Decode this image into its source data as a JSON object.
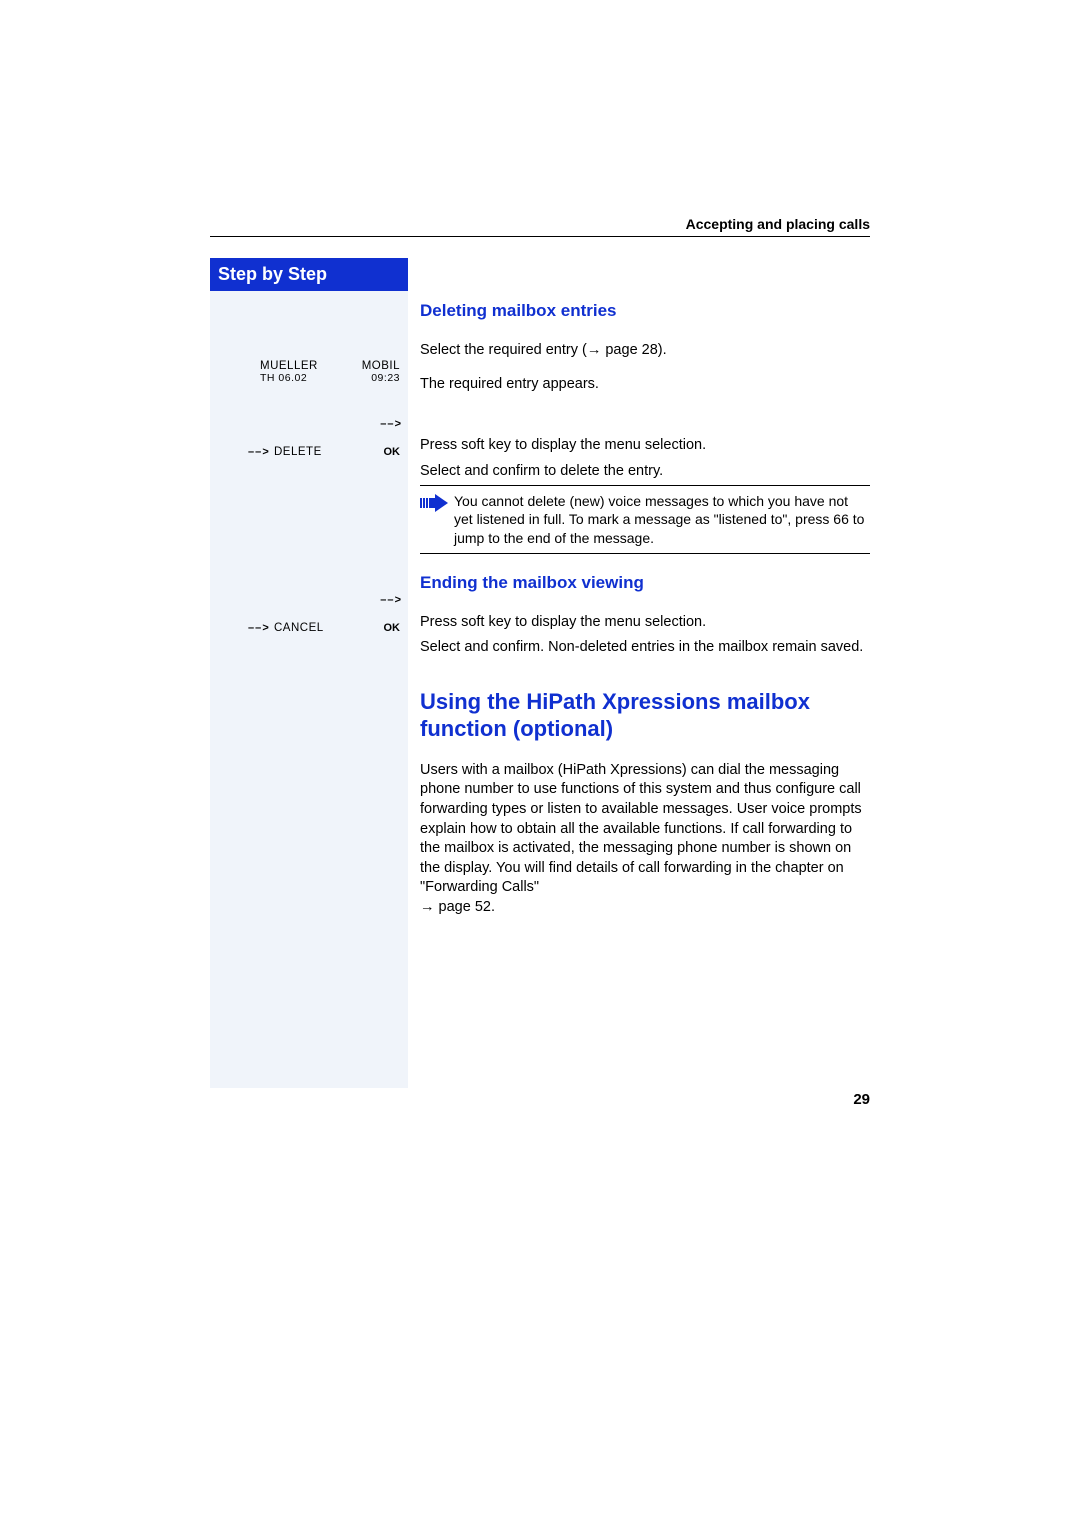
{
  "header": {
    "section_title": "Accepting and placing calls"
  },
  "left": {
    "step_title": "Step by Step",
    "phone_display": {
      "name": "MUELLER",
      "type": "MOBIL",
      "date": "TH 06.02",
      "time": "09:23"
    },
    "arrow_glyph": "– – >",
    "step_delete": {
      "prefix": "– – >",
      "label": "DELETE",
      "ok": "OK"
    },
    "step_cancel_arrow": "– – >",
    "step_cancel": {
      "prefix": "– – >",
      "label": "CANCEL",
      "ok": "OK"
    }
  },
  "right": {
    "h3_delete": "Deleting mailbox entries",
    "p_select_required": "Select the required entry (",
    "p_select_required_link": " page 28).",
    "p_required_appears": "The required entry appears.",
    "p_press_soft_1": "Press soft key to display the menu selection.",
    "p_select_confirm_delete": "Select and confirm to delete the entry.",
    "note_text": "You cannot delete (new) voice messages to which you have not yet listened in full. To mark a message as \"listened to\", press 66 to jump to the end of the message.",
    "h3_end": "Ending the mailbox viewing",
    "p_press_soft_2": "Press soft key to display the menu selection.",
    "p_select_confirm_end": "Select and confirm. Non-deleted entries in the mailbox remain saved.",
    "h2_hipath": "Using the HiPath Xpressions mailbox function (optional)",
    "p_hipath_body": "Users with a mailbox (HiPath Xpressions) can dial the messaging phone number to use functions of this system and thus configure call forwarding types or listen to available messages. User voice prompts explain how to obtain all the available functions. If call forwarding to the mailbox is activated, the messaging phone number is shown on the display. You will find details of call forwarding in the chapter on \"Forwarding Calls\"",
    "p_hipath_ref": " page 52."
  },
  "page_number": "29"
}
